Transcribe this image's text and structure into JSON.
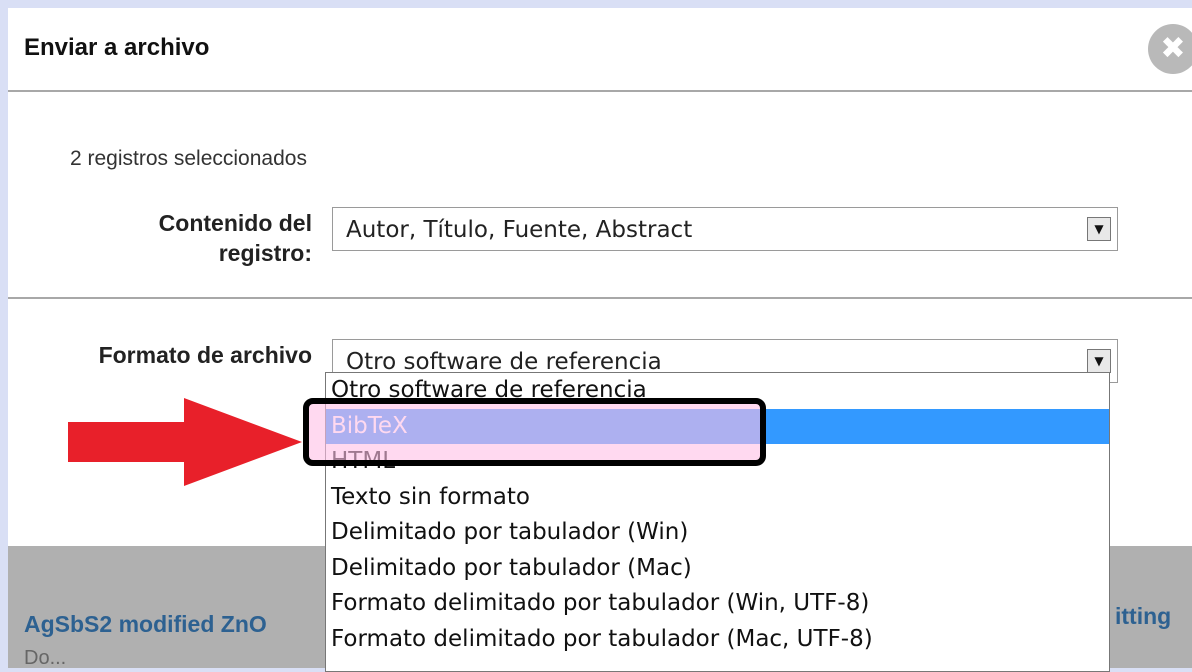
{
  "dialog": {
    "title": "Enviar a archivo",
    "close_icon": "close-icon",
    "records_count": "2 registros seleccionados"
  },
  "content_field": {
    "label": "Contenido del registro:",
    "label_line1": "Contenido del",
    "label_line2": "registro:",
    "value": "Autor, Título, Fuente, Abstract"
  },
  "format_field": {
    "label": "Formato de archivo",
    "value": "Otro software de referencia",
    "options": [
      "Otro software de referencia",
      "BibTeX",
      "HTML",
      "Texto sin formato",
      "Delimitado por tabulador (Win)",
      "Delimitado por tabulador (Mac)",
      "Formato delimitado por tabulador (Win, UTF-8)",
      "Formato delimitado por tabulador (Mac, UTF-8)"
    ],
    "highlighted_option": "BibTeX"
  },
  "background": {
    "article_title_left": "AgSbS2 modified ZnO",
    "article_title_right": "itting",
    "article_snippet": "Do..."
  },
  "annotation": {
    "arrow_color": "#e8202a",
    "highlight_border_color": "#000000",
    "selection_color": "#3399ff"
  }
}
